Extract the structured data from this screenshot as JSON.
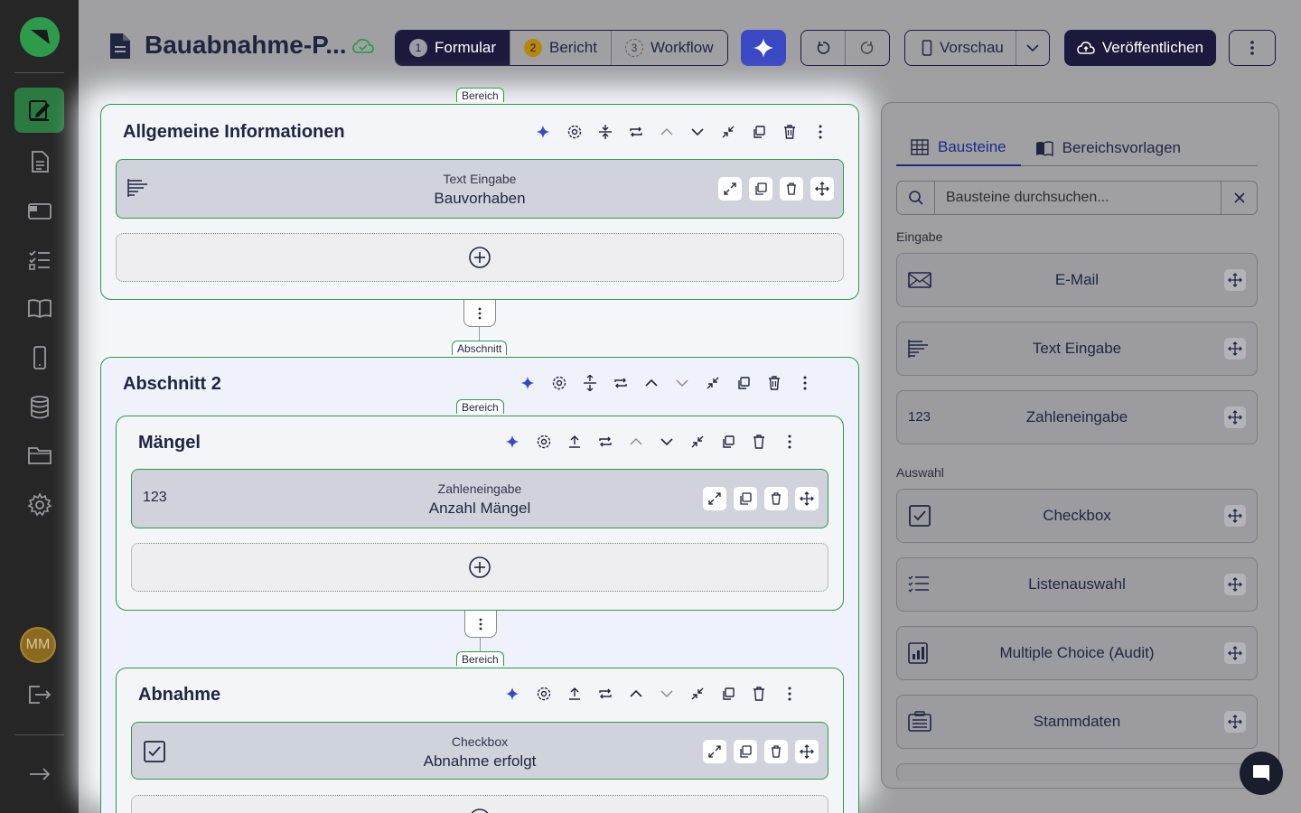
{
  "app": {
    "doc_title": "Bauabnahme-P...",
    "steps": [
      {
        "num": "1",
        "label": "Formular"
      },
      {
        "num": "2",
        "label": "Bericht"
      },
      {
        "num": "3",
        "label": "Workflow"
      }
    ],
    "preview_label": "Vorschau",
    "publish_label": "Veröffentlichen"
  },
  "user": {
    "initials": "MM"
  },
  "canvas": {
    "tag_bereich": "Bereich",
    "tag_abschnitt": "Abschnitt",
    "section1": {
      "title": "Allgemeine Informationen",
      "field": {
        "type": "Text Eingabe",
        "name": "Bauvorhaben"
      }
    },
    "section2": {
      "title": "Abschnitt 2",
      "sub1": {
        "title": "Mängel",
        "field": {
          "type": "Zahleneingabe",
          "name": "Anzahl Mängel",
          "icon_text": "123"
        }
      },
      "sub2": {
        "title": "Abnahme",
        "field": {
          "type": "Checkbox",
          "name": "Abnahme erfolgt"
        }
      }
    }
  },
  "panel": {
    "tabs": [
      "Bausteine",
      "Bereichsvorlagen"
    ],
    "search_placeholder": "Bausteine durchsuchen...",
    "group_input": "Eingabe",
    "group_select": "Auswahl",
    "blocks": [
      {
        "label": "E-Mail",
        "icon": "envelope-icon"
      },
      {
        "label": "Text Eingabe",
        "icon": "text-lines-icon"
      },
      {
        "label": "Zahleneingabe",
        "icon": "number-icon",
        "icon_text": "123"
      },
      {
        "label": "Checkbox",
        "icon": "checkbox-icon"
      },
      {
        "label": "Listenauswahl",
        "icon": "list-icon"
      },
      {
        "label": "Multiple Choice (Audit)",
        "icon": "bar-chart-icon"
      },
      {
        "label": "Stammdaten",
        "icon": "master-data-icon"
      }
    ]
  },
  "colors": {
    "accent_green": "#2e9a4c",
    "dark_navy": "#1c1a3c",
    "ai_blue": "#3b48c4"
  }
}
